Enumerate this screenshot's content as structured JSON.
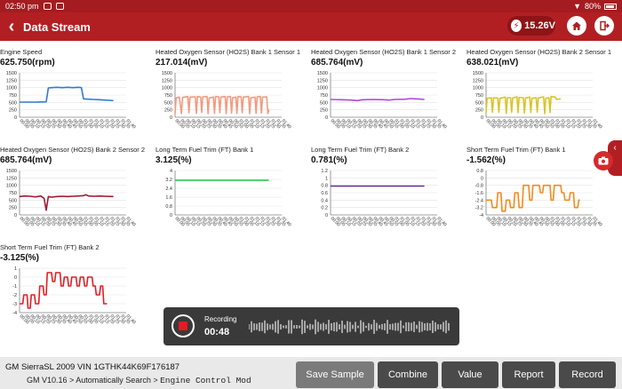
{
  "statusbar": {
    "time": "02:50 pm",
    "battery": "80%"
  },
  "header": {
    "title": "Data Stream",
    "voltage": "15.26V"
  },
  "panels": [
    {
      "name": "Engine Speed",
      "value": "625.750(rpm)",
      "ticks": [
        "1500",
        "1250",
        "1000",
        "750",
        "500",
        "250",
        "0"
      ],
      "ymin": 0,
      "ymax": 1500,
      "color": "#2f7ad6",
      "points": [
        [
          0,
          510
        ],
        [
          5,
          510
        ],
        [
          10,
          510
        ],
        [
          15,
          510
        ],
        [
          20,
          515
        ],
        [
          25,
          520
        ],
        [
          27,
          990
        ],
        [
          30,
          1000
        ],
        [
          35,
          1010
        ],
        [
          40,
          1000
        ],
        [
          45,
          1010
        ],
        [
          50,
          1000
        ],
        [
          55,
          1010
        ],
        [
          58,
          1000
        ],
        [
          60,
          620
        ],
        [
          65,
          610
        ],
        [
          70,
          600
        ],
        [
          75,
          590
        ],
        [
          80,
          580
        ],
        [
          85,
          570
        ],
        [
          88,
          560
        ]
      ]
    },
    {
      "name": "Heated Oxygen Sensor (HO2S) Bank 1 Sensor 1",
      "value": "217.014(mV)",
      "ticks": [
        "1500",
        "1250",
        "1000",
        "750",
        "500",
        "250",
        "0"
      ],
      "ymin": 0,
      "ymax": 1500,
      "color": "#f29a80",
      "points": [
        [
          0,
          120
        ],
        [
          1,
          650
        ],
        [
          4,
          680
        ],
        [
          6,
          120
        ],
        [
          7,
          670
        ],
        [
          12,
          700
        ],
        [
          13,
          150
        ],
        [
          14,
          680
        ],
        [
          19,
          690
        ],
        [
          20,
          130
        ],
        [
          21,
          700
        ],
        [
          24,
          680
        ],
        [
          25,
          160
        ],
        [
          26,
          690
        ],
        [
          30,
          700
        ],
        [
          31,
          120
        ],
        [
          32,
          650
        ],
        [
          36,
          680
        ],
        [
          37,
          130
        ],
        [
          38,
          700
        ],
        [
          41,
          690
        ],
        [
          42,
          150
        ],
        [
          43,
          680
        ],
        [
          47,
          700
        ],
        [
          48,
          120
        ],
        [
          49,
          690
        ],
        [
          52,
          700
        ],
        [
          53,
          140
        ],
        [
          54,
          660
        ],
        [
          57,
          680
        ],
        [
          58,
          130
        ],
        [
          59,
          700
        ],
        [
          62,
          690
        ],
        [
          63,
          150
        ],
        [
          64,
          680
        ],
        [
          69,
          700
        ],
        [
          70,
          120
        ],
        [
          71,
          650
        ],
        [
          75,
          680
        ],
        [
          76,
          130
        ],
        [
          77,
          690
        ],
        [
          80,
          700
        ],
        [
          81,
          140
        ],
        [
          82,
          680
        ],
        [
          86,
          690
        ],
        [
          87,
          120
        ],
        [
          88,
          260
        ]
      ]
    },
    {
      "name": "Heated Oxygen Sensor (HO2S) Bank 1 Sensor 2",
      "value": "685.764(mV)",
      "ticks": [
        "1500",
        "1250",
        "1000",
        "750",
        "500",
        "250",
        "0"
      ],
      "ymin": 0,
      "ymax": 1500,
      "color": "#b347d6",
      "points": [
        [
          0,
          600
        ],
        [
          10,
          590
        ],
        [
          20,
          580
        ],
        [
          25,
          560
        ],
        [
          30,
          590
        ],
        [
          40,
          600
        ],
        [
          50,
          590
        ],
        [
          55,
          580
        ],
        [
          60,
          600
        ],
        [
          70,
          610
        ],
        [
          75,
          630
        ],
        [
          80,
          620
        ],
        [
          85,
          610
        ],
        [
          88,
          600
        ]
      ]
    },
    {
      "name": "Heated Oxygen Sensor (HO2S) Bank 2 Sensor 1",
      "value": "638.021(mV)",
      "ticks": [
        "1500",
        "1250",
        "1000",
        "750",
        "500",
        "250",
        "0"
      ],
      "ymin": 0,
      "ymax": 1500,
      "color": "#d8c42a",
      "points": [
        [
          0,
          150
        ],
        [
          1,
          640
        ],
        [
          5,
          660
        ],
        [
          6,
          170
        ],
        [
          7,
          660
        ],
        [
          11,
          650
        ],
        [
          12,
          170
        ],
        [
          13,
          640
        ],
        [
          18,
          680
        ],
        [
          19,
          130
        ],
        [
          20,
          660
        ],
        [
          23,
          660
        ],
        [
          24,
          170
        ],
        [
          25,
          650
        ],
        [
          29,
          690
        ],
        [
          30,
          150
        ],
        [
          31,
          670
        ],
        [
          35,
          660
        ],
        [
          36,
          140
        ],
        [
          37,
          650
        ],
        [
          41,
          680
        ],
        [
          42,
          160
        ],
        [
          43,
          640
        ],
        [
          47,
          660
        ],
        [
          48,
          170
        ],
        [
          49,
          650
        ],
        [
          54,
          690
        ],
        [
          55,
          120
        ],
        [
          56,
          640
        ],
        [
          59,
          660
        ],
        [
          60,
          160
        ],
        [
          61,
          700
        ],
        [
          65,
          680
        ],
        [
          66,
          600
        ],
        [
          70,
          620
        ]
      ]
    },
    {
      "name": "Heated Oxygen Sensor (HO2S) Bank 2 Sensor 2",
      "value": "685.764(mV)",
      "ticks": [
        "1500",
        "1250",
        "1000",
        "750",
        "500",
        "250",
        "0"
      ],
      "ymin": 0,
      "ymax": 1500,
      "color": "#9e1a35",
      "points": [
        [
          0,
          620
        ],
        [
          5,
          640
        ],
        [
          10,
          630
        ],
        [
          15,
          610
        ],
        [
          20,
          640
        ],
        [
          23,
          560
        ],
        [
          25,
          160
        ],
        [
          27,
          620
        ],
        [
          30,
          600
        ],
        [
          35,
          620
        ],
        [
          40,
          630
        ],
        [
          45,
          620
        ],
        [
          50,
          630
        ],
        [
          55,
          640
        ],
        [
          60,
          650
        ],
        [
          62,
          680
        ],
        [
          65,
          640
        ],
        [
          70,
          630
        ],
        [
          75,
          640
        ],
        [
          80,
          630
        ],
        [
          88,
          620
        ]
      ]
    },
    {
      "name": "Long Term Fuel Trim (FT) Bank 1",
      "value": "3.125(%)",
      "ticks": [
        "4",
        "3.2",
        "2.4",
        "1.6",
        "0.8",
        "0"
      ],
      "ymin": 0,
      "ymax": 4,
      "color": "#2ec85a",
      "points": [
        [
          0,
          3.125
        ],
        [
          88,
          3.125
        ]
      ]
    },
    {
      "name": "Long Term Fuel Trim (FT) Bank 2",
      "value": "0.781(%)",
      "ticks": [
        "1.2",
        "1",
        "0.8",
        "0.6",
        "0.4",
        "0.2",
        "0"
      ],
      "ymin": 0,
      "ymax": 1.2,
      "color": "#6a2a8e",
      "points": [
        [
          0,
          0.781
        ],
        [
          88,
          0.781
        ]
      ]
    },
    {
      "name": "Short Term Fuel Trim (FT) Bank 1",
      "value": "-1.562(%)",
      "ticks": [
        "0.8",
        "0",
        "-0.8",
        "-1.6",
        "-2.4",
        "-3.2",
        "-4"
      ],
      "ymin": -4,
      "ymax": 0.8,
      "color": "#f28a1e",
      "points": [
        [
          0,
          -2.4
        ],
        [
          5,
          -2.4
        ],
        [
          6,
          -3.2
        ],
        [
          10,
          -3.2
        ],
        [
          11,
          -1.6
        ],
        [
          14,
          -1.6
        ],
        [
          15,
          -3.6
        ],
        [
          18,
          -3.6
        ],
        [
          19,
          -2.4
        ],
        [
          22,
          -2.4
        ],
        [
          23,
          -3.2
        ],
        [
          26,
          -3.2
        ],
        [
          27,
          -1.6
        ],
        [
          30,
          -1.6
        ],
        [
          31,
          -3.2
        ],
        [
          34,
          -3.2
        ],
        [
          35,
          -0.8
        ],
        [
          40,
          -0.8
        ],
        [
          41,
          -2.4
        ],
        [
          43,
          -2.4
        ],
        [
          44,
          -0.8
        ],
        [
          50,
          -0.8
        ],
        [
          51,
          -1.6
        ],
        [
          53,
          -1.6
        ],
        [
          54,
          -0.8
        ],
        [
          60,
          -0.8
        ],
        [
          61,
          -2.4
        ],
        [
          63,
          -2.4
        ],
        [
          64,
          -0.8
        ],
        [
          70,
          -0.8
        ],
        [
          71,
          -1.6
        ],
        [
          73,
          -1.6
        ],
        [
          74,
          -2.4
        ],
        [
          78,
          -2.4
        ],
        [
          79,
          -1.6
        ],
        [
          82,
          -1.6
        ],
        [
          83,
          -3.2
        ],
        [
          86,
          -3.2
        ],
        [
          87,
          -2.4
        ],
        [
          88,
          -2.4
        ]
      ]
    },
    {
      "name": "Short Term Fuel Trim (FT) Bank 2",
      "value": "-3.125(%)",
      "ticks": [
        "1",
        "0",
        "-1",
        "-2",
        "-3",
        "-4"
      ],
      "ymin": -4,
      "ymax": 1,
      "color": "#e01f26",
      "points": [
        [
          0,
          -3
        ],
        [
          3,
          -3
        ],
        [
          4,
          -2
        ],
        [
          7,
          -2
        ],
        [
          8,
          -3.5
        ],
        [
          10,
          -3.5
        ],
        [
          11,
          -2
        ],
        [
          14,
          -2
        ],
        [
          15,
          -3
        ],
        [
          18,
          -3
        ],
        [
          19,
          -1
        ],
        [
          22,
          -1
        ],
        [
          23,
          -2
        ],
        [
          25,
          -2
        ],
        [
          26,
          0.5
        ],
        [
          30,
          0.5
        ],
        [
          31,
          -0.5
        ],
        [
          33,
          -0.5
        ],
        [
          34,
          0.5
        ],
        [
          38,
          0.5
        ],
        [
          39,
          -1
        ],
        [
          41,
          -1
        ],
        [
          42,
          0
        ],
        [
          45,
          0
        ],
        [
          46,
          -1
        ],
        [
          48,
          -1
        ],
        [
          49,
          0
        ],
        [
          53,
          0
        ],
        [
          54,
          -1
        ],
        [
          56,
          -1
        ],
        [
          57,
          0
        ],
        [
          60,
          0
        ],
        [
          61,
          -1
        ],
        [
          63,
          -1
        ],
        [
          64,
          0
        ],
        [
          68,
          0
        ],
        [
          69,
          -1
        ],
        [
          71,
          -1
        ],
        [
          72,
          -2
        ],
        [
          75,
          -2
        ],
        [
          76,
          -1
        ],
        [
          78,
          -1
        ],
        [
          79,
          -3
        ],
        [
          82,
          -3
        ]
      ]
    }
  ],
  "x_ticks": [
    "00:00",
    "00:05",
    "00:10",
    "00:15",
    "00:20",
    "00:25",
    "00:30",
    "00:35",
    "00:40",
    "00:45",
    "00:50",
    "00:55",
    "01:00",
    "01:05",
    "01:10",
    "01:15",
    "01:20",
    "01:25",
    "01:30",
    "01:35",
    "01:40"
  ],
  "recording": {
    "label": "Recording",
    "time": "00:48"
  },
  "vehicle": {
    "line1": "GM  SierraSL  2009  VIN  1GTHK44K69F176187",
    "path_prefix": "GM V10.16 > Automatically Search > ",
    "path_module": "Engine Control Mod"
  },
  "buttons": {
    "save_sample": "Save Sample",
    "combine": "Combine",
    "value": "Value",
    "report": "Report",
    "record": "Record"
  }
}
